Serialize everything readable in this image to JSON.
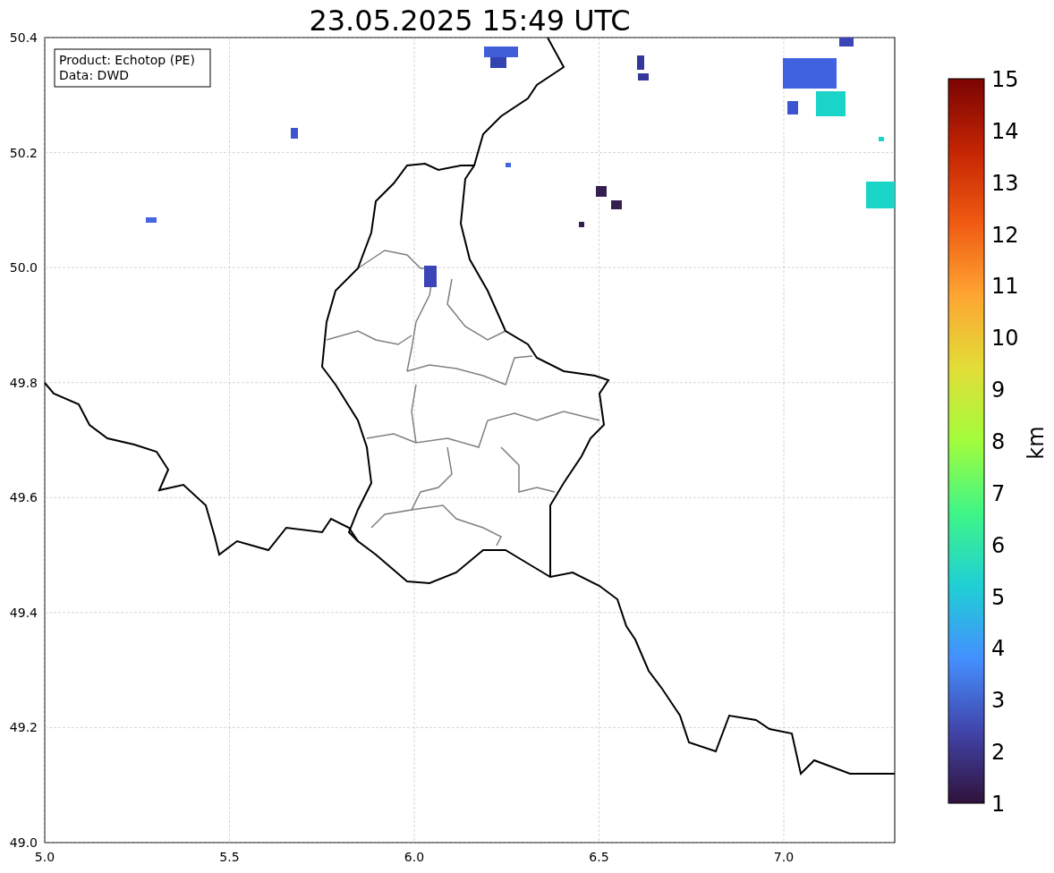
{
  "title": "23.05.2025 15:49 UTC",
  "info_box": [
    "Product: Echotop (PE)",
    "Data: DWD"
  ],
  "x_ticks": [
    "5.0",
    "5.5",
    "6.0",
    "6.5",
    "7.0"
  ],
  "y_ticks": [
    "50.4",
    "50.2",
    "50.0",
    "49.8",
    "49.6",
    "49.4",
    "49.2",
    "49.0"
  ],
  "colorbar": {
    "label": "km",
    "ticks": [
      "15",
      "14",
      "13",
      "12",
      "11",
      "10",
      "9",
      "8",
      "7",
      "6",
      "5",
      "4",
      "3",
      "2",
      "1"
    ]
  }
}
